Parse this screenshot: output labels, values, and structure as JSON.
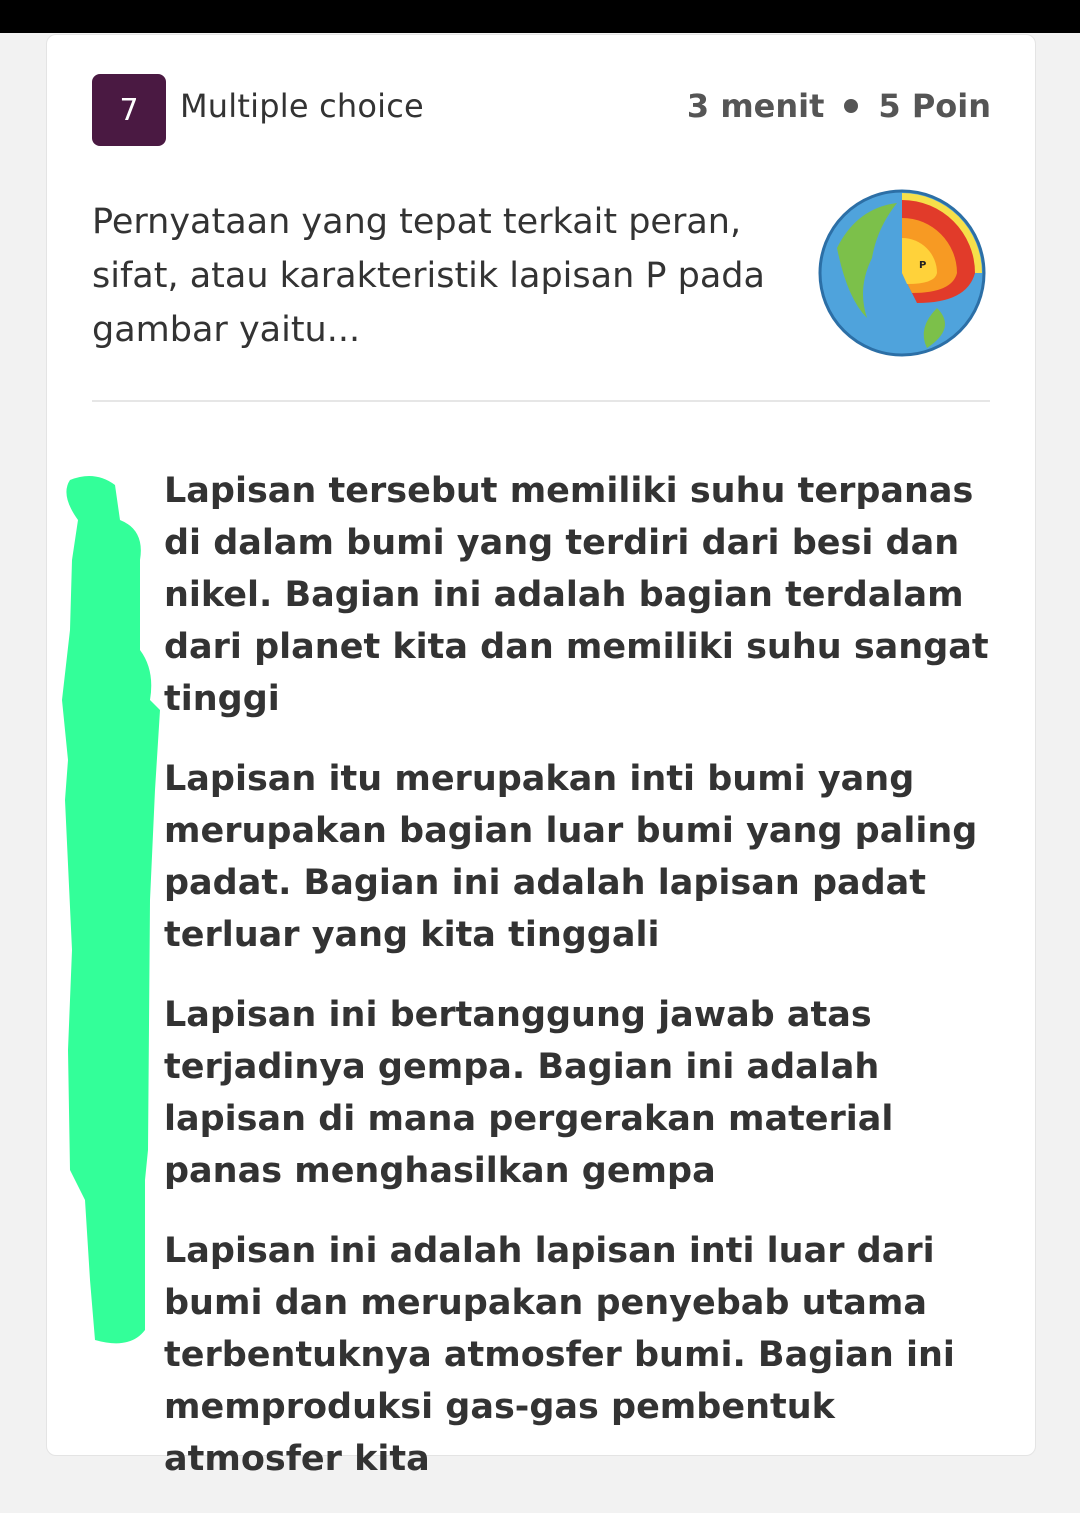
{
  "question": {
    "number": "7",
    "type_label": "Multiple choice",
    "time": "3 menit",
    "points": "5 Poin",
    "text_lines": [
      "Pernyataan yang tepat terkait peran,",
      "sifat, atau karakteristik lapisan P pada",
      "gambar yaitu..."
    ],
    "image_label": "P"
  },
  "options": [
    "Lapisan tersebut memiliki suhu terpanas di dalam bumi yang terdiri dari besi dan nikel. Bagian ini adalah bagian terdalam dari planet kita dan memiliki suhu sangat tinggi",
    "Lapisan itu merupakan inti bumi yang merupakan bagian luar bumi yang paling padat. Bagian ini adalah lapisan padat terluar yang kita tinggali",
    "Lapisan ini bertanggung jawab atas terjadinya gempa. Bagian ini adalah lapisan di mana pergerakan material panas menghasilkan gempa",
    "Lapisan ini adalah lapisan inti luar dari bumi dan merupakan penyebab utama terbentuknya atmosfer bumi. Bagian ini memproduksi gas-gas pembentuk atmosfer kita"
  ],
  "colors": {
    "badge": "#4a1942",
    "highlight": "#33ff99"
  }
}
